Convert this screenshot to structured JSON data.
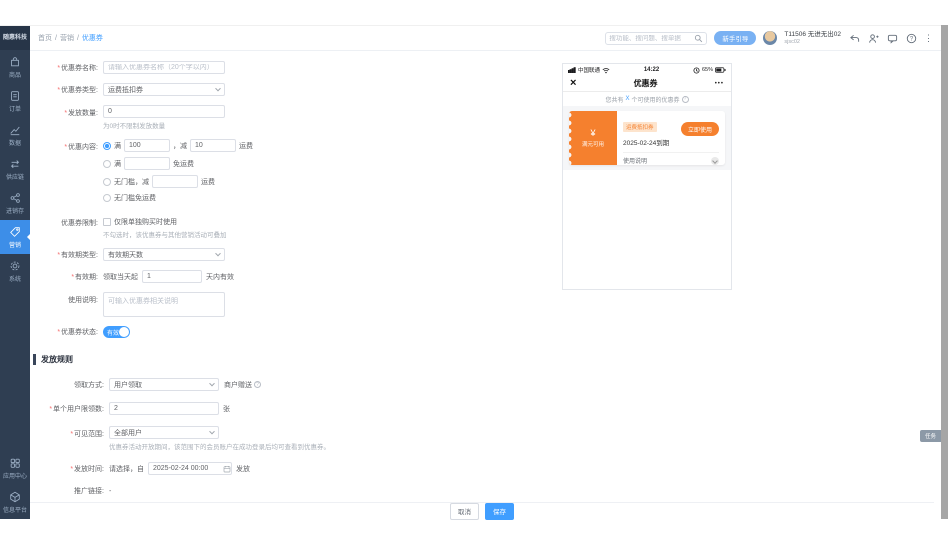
{
  "colors": {
    "accent": "#409eff",
    "orange": "#f5802e",
    "sidebar_bg": "#2f3e52"
  },
  "marks": {
    "question": "?"
  },
  "sidebar": {
    "logo": "随惠科技",
    "items": [
      {
        "label": "商品"
      },
      {
        "label": "订单"
      },
      {
        "label": "数据"
      },
      {
        "label": "供应链"
      },
      {
        "label": "进销存"
      },
      {
        "label": "营销"
      },
      {
        "label": "系统"
      }
    ],
    "bottom_items": [
      {
        "label": "应用中心"
      },
      {
        "label": "信息平台"
      }
    ]
  },
  "header": {
    "breadcrumb": {
      "home": "首页",
      "section": "营销",
      "current": "优惠券",
      "sep": "/"
    },
    "search_placeholder": "搜功能、搜问题、搜单据",
    "guide_button": "新手引导",
    "user": {
      "name": "T11506 无进无出02",
      "account": "sjsc02"
    },
    "more": "⋮"
  },
  "form": {
    "name": {
      "label": "优惠券名称:",
      "placeholder": "请输入优惠券名称（20个字以内）"
    },
    "type": {
      "label": "优惠券类型:",
      "value": "运费抵扣券"
    },
    "quantity": {
      "label": "发放数量:",
      "value": "0",
      "hint": "为0时不限制发放数量"
    },
    "content": {
      "label": "优惠内容:",
      "options": [
        {
          "prefix": "满",
          "v1": "100",
          "mid": "，减",
          "v2": "10",
          "suffix": "运费"
        },
        {
          "prefix": "满",
          "suffix": "免运费"
        },
        {
          "prefix": "无门槛，减",
          "suffix": "运费"
        },
        {
          "prefix": "无门槛免运费"
        }
      ]
    },
    "restriction": {
      "label": "优惠券限制:",
      "checkbox_label": "仅限单独购买时使用",
      "hint": "不勾选时，该优惠券与其他营销活动可叠加"
    },
    "validity_type": {
      "label": "有效期类型:",
      "value": "有效期天数"
    },
    "validity": {
      "label": "有效期:",
      "prefix": "领取当天起",
      "value": "1",
      "suffix": "天内有效"
    },
    "usage_note": {
      "label": "使用说明:",
      "placeholder": "可输入优惠券相关说明"
    },
    "status": {
      "label": "优惠券状态:",
      "toggle_label": "有效"
    }
  },
  "rules": {
    "title": "发放规则",
    "claim_method": {
      "label": "领取方式:",
      "value": "用户领取",
      "side": "商户赠送"
    },
    "per_user_limit": {
      "label": "单个用户限领数:",
      "value": "2",
      "unit": "张"
    },
    "visibility": {
      "label": "可见范围:",
      "value": "全部用户",
      "hint": "优惠券活动开放期间，该范围下的会员账户在成功登录后均可查看到优惠券。"
    },
    "issue_time": {
      "label": "发放时间:",
      "prefix": "请选择，自",
      "value": "2025-02-24 00:00",
      "suffix": "发放"
    },
    "promo_link": {
      "label": "推广链接:",
      "value": "-"
    }
  },
  "footer": {
    "cancel": "取消",
    "save": "保存"
  },
  "preview": {
    "status_bar": {
      "carrier": "中国联通",
      "time": "14:22",
      "battery": "65%"
    },
    "nav": {
      "close": "×",
      "title": "优惠券",
      "more": "•••"
    },
    "info": {
      "pre": "您共有",
      "count": "X",
      "post": "个可使用的优惠券"
    },
    "coupon": {
      "currency": "¥",
      "left_text": "满元可用",
      "badge": "运费抵扣券",
      "expire": "2025-02-24到期",
      "use_button": "立即使用",
      "note": "使用说明"
    }
  },
  "side_tab": "任务"
}
